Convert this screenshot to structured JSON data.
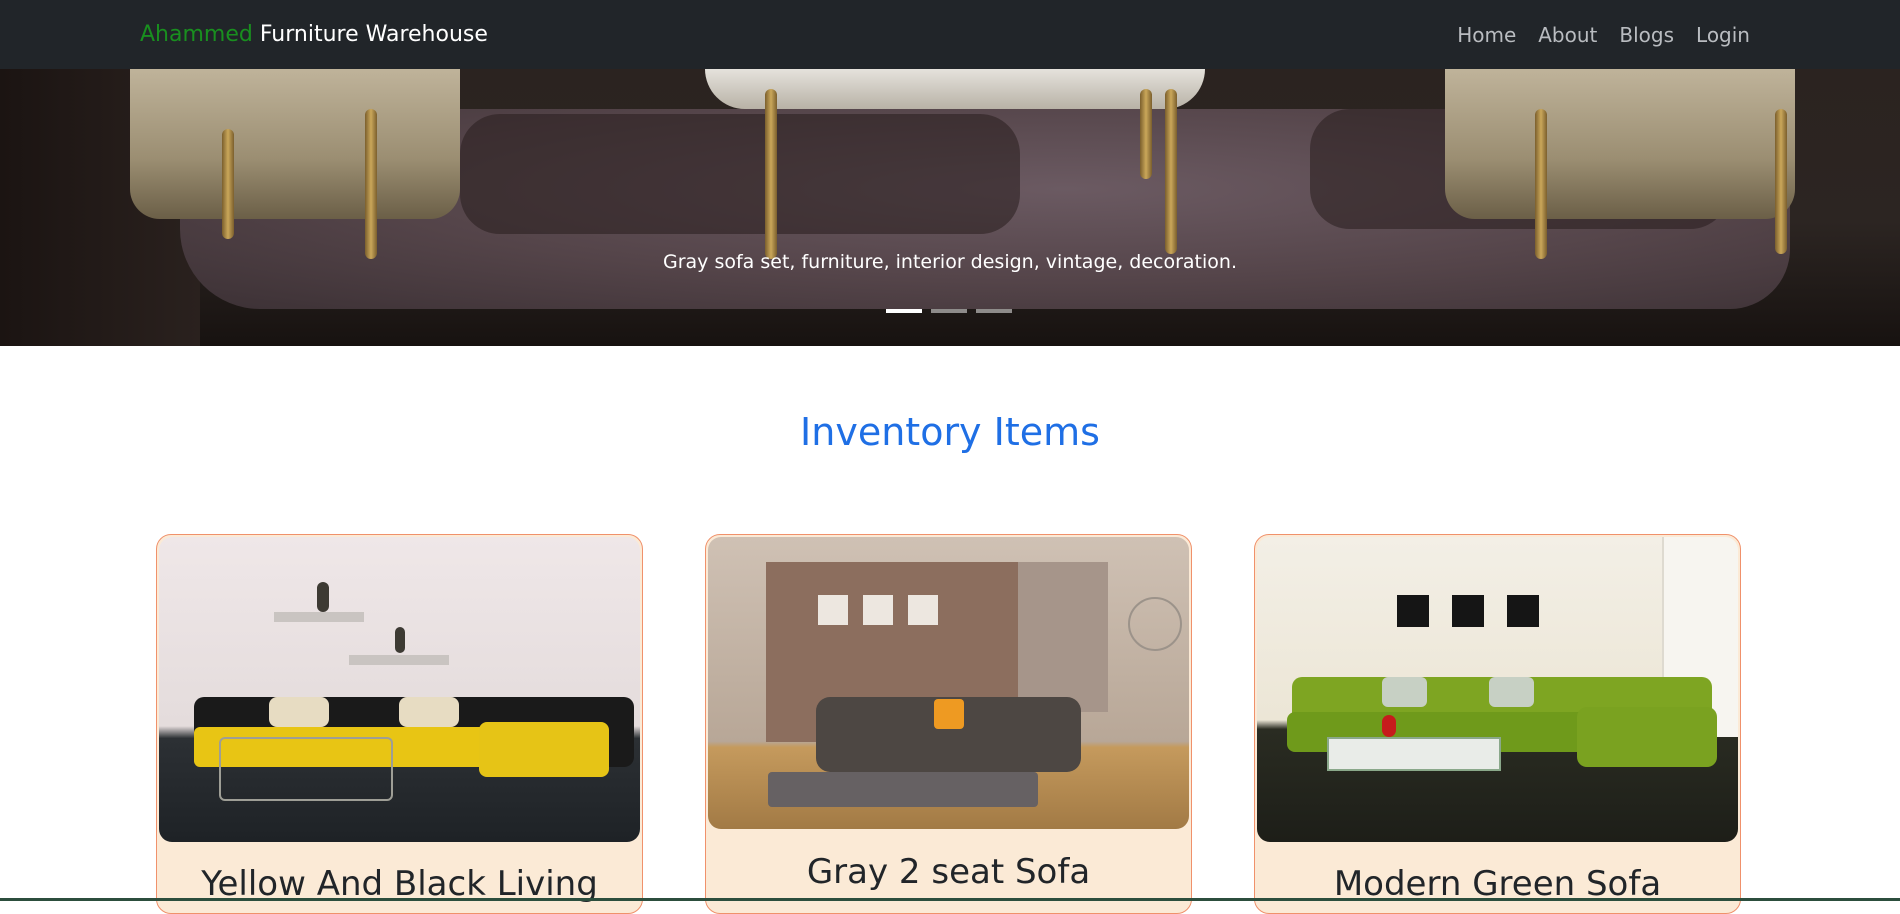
{
  "navbar": {
    "brand_first": "Ahammed",
    "brand_rest": "Furniture Warehouse",
    "links": [
      "Home",
      "About",
      "Blogs",
      "Login"
    ]
  },
  "hero": {
    "caption": "Gray sofa set, furniture, interior design, vintage, decoration.",
    "slide_count": 3,
    "active_slide": 1
  },
  "inventory": {
    "title": "Inventory Items",
    "items": [
      {
        "name": "Yellow And Black Living"
      },
      {
        "name": "Gray 2 seat Sofa"
      },
      {
        "name": "Modern Green Sofa"
      }
    ]
  },
  "colors": {
    "navbar_bg": "#212529",
    "brand_accent": "#198f1f",
    "title_blue": "#1f6fe5",
    "card_border": "#f0916b",
    "card_bg": "#fbead6"
  }
}
